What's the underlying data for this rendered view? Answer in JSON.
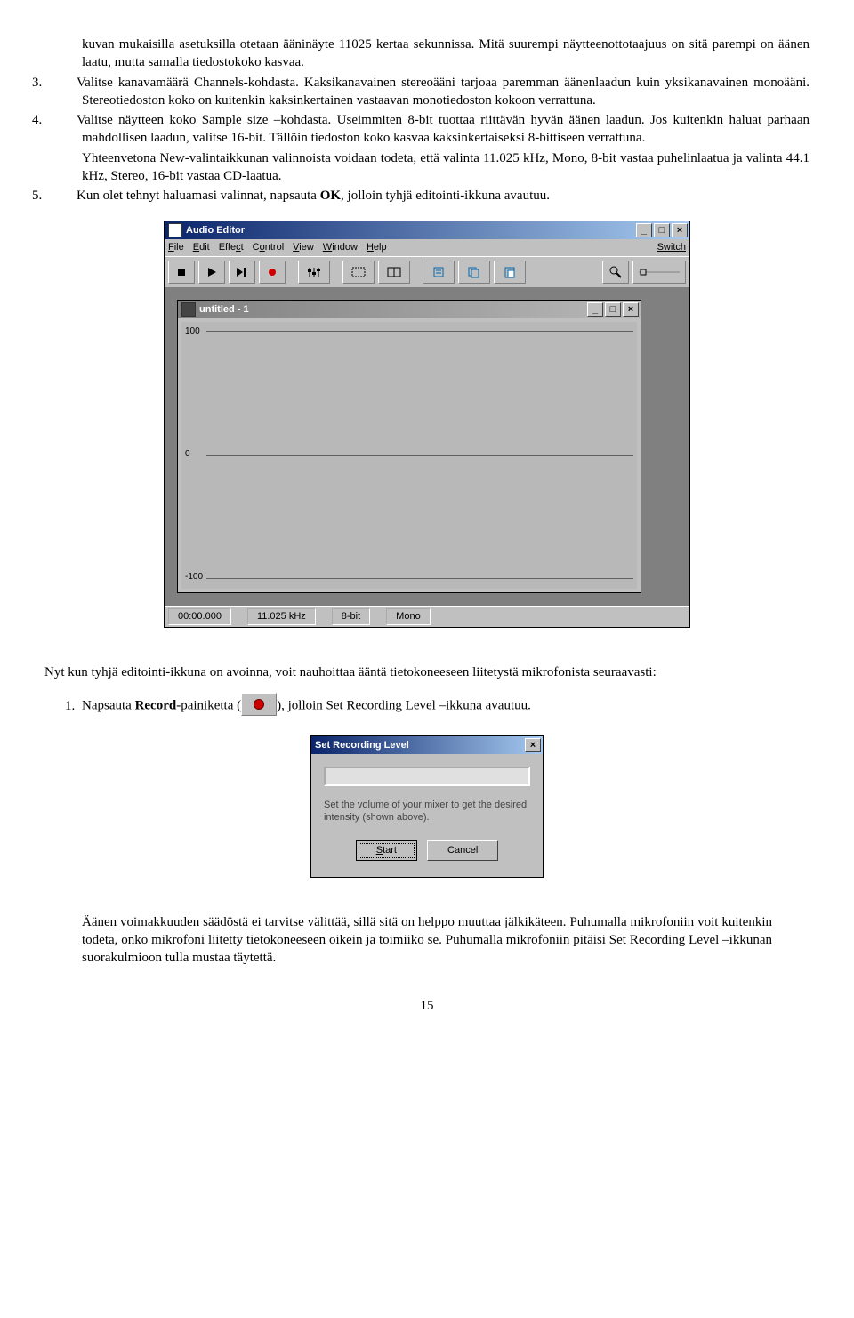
{
  "text": {
    "p_cont": "kuvan mukaisilla asetuksilla otetaan ääninäyte 11025 kertaa sekunnissa. Mitä suurempi näytteenottotaajuus on sitä parempi on äänen laatu, mutta samalla tiedostokoko kasvaa.",
    "li3": "Valitse kanavamäärä Channels-kohdasta. Kaksikanavainen stereoääni tarjoaa paremman äänenlaadun kuin yksikanavainen monoääni. Stereotiedoston koko on kuitenkin kaksinkertainen vastaavan monotiedoston kokoon verrattuna.",
    "li4a": "Valitse näytteen koko Sample size –kohdasta. Useimmiten 8-bit tuottaa riittävän hyvän äänen laadun. Jos kuitenkin haluat parhaan mahdollisen laadun, valitse 16-bit. Tällöin tiedoston koko kasvaa kaksinkertaiseksi 8-bittiseen verrattuna.",
    "li4b": "Yhteenvetona New-valintaikkunan valinnoista voidaan todeta, että valinta 11.025 kHz, Mono, 8-bit vastaa puhelinlaatua ja valinta 44.1 kHz, Stereo, 16-bit vastaa CD-laatua.",
    "li5a": "Kun olet tehnyt haluamasi valinnat, napsauta ",
    "li5b": "OK",
    "li5c": ", jolloin tyhjä editointi-ikkuna avautuu.",
    "num3": "3.",
    "num4": "4.",
    "num5": "5.",
    "mid1": "Nyt kun tyhjä editointi-ikkuna on avoinna, voit nauhoittaa ääntä tietokoneeseen liitetystä mikrofonista seuraavasti:",
    "li_rec_a": "Napsauta ",
    "li_rec_b": "Record",
    "li_rec_c": "-painiketta (",
    "li_rec_d": "), jolloin Set Recording Level –ikkuna avautuu.",
    "bottom": "Äänen voimakkuuden säädöstä ei tarvitse välittää, sillä sitä on helppo muuttaa jälkikäteen. Puhumalla mikrofoniin voit kuitenkin todeta, onko mikrofoni liitetty tietokoneeseen oikein ja toimiiko se. Puhumalla mikrofoniin pitäisi Set Recording Level –ikkunan suorakulmioon tulla mustaa täytettä.",
    "page": "15"
  },
  "editor": {
    "title": "Audio Editor",
    "menus": {
      "file": "File",
      "edit": "Edit",
      "effect": "Effect",
      "control": "Control",
      "view": "View",
      "window": "Window",
      "help": "Help",
      "switch": "Switch"
    },
    "doc_title": "untitled - 1",
    "axis": {
      "top": "100",
      "mid": "0",
      "bot": "-100"
    },
    "status": {
      "time": "00:00.000",
      "rate": "11.025 kHz",
      "bits": "8-bit",
      "ch": "Mono"
    }
  },
  "dialog": {
    "title": "Set Recording Level",
    "text": "Set the volume of your mixer to get the desired intensity (shown above).",
    "start": "Start",
    "cancel": "Cancel"
  }
}
